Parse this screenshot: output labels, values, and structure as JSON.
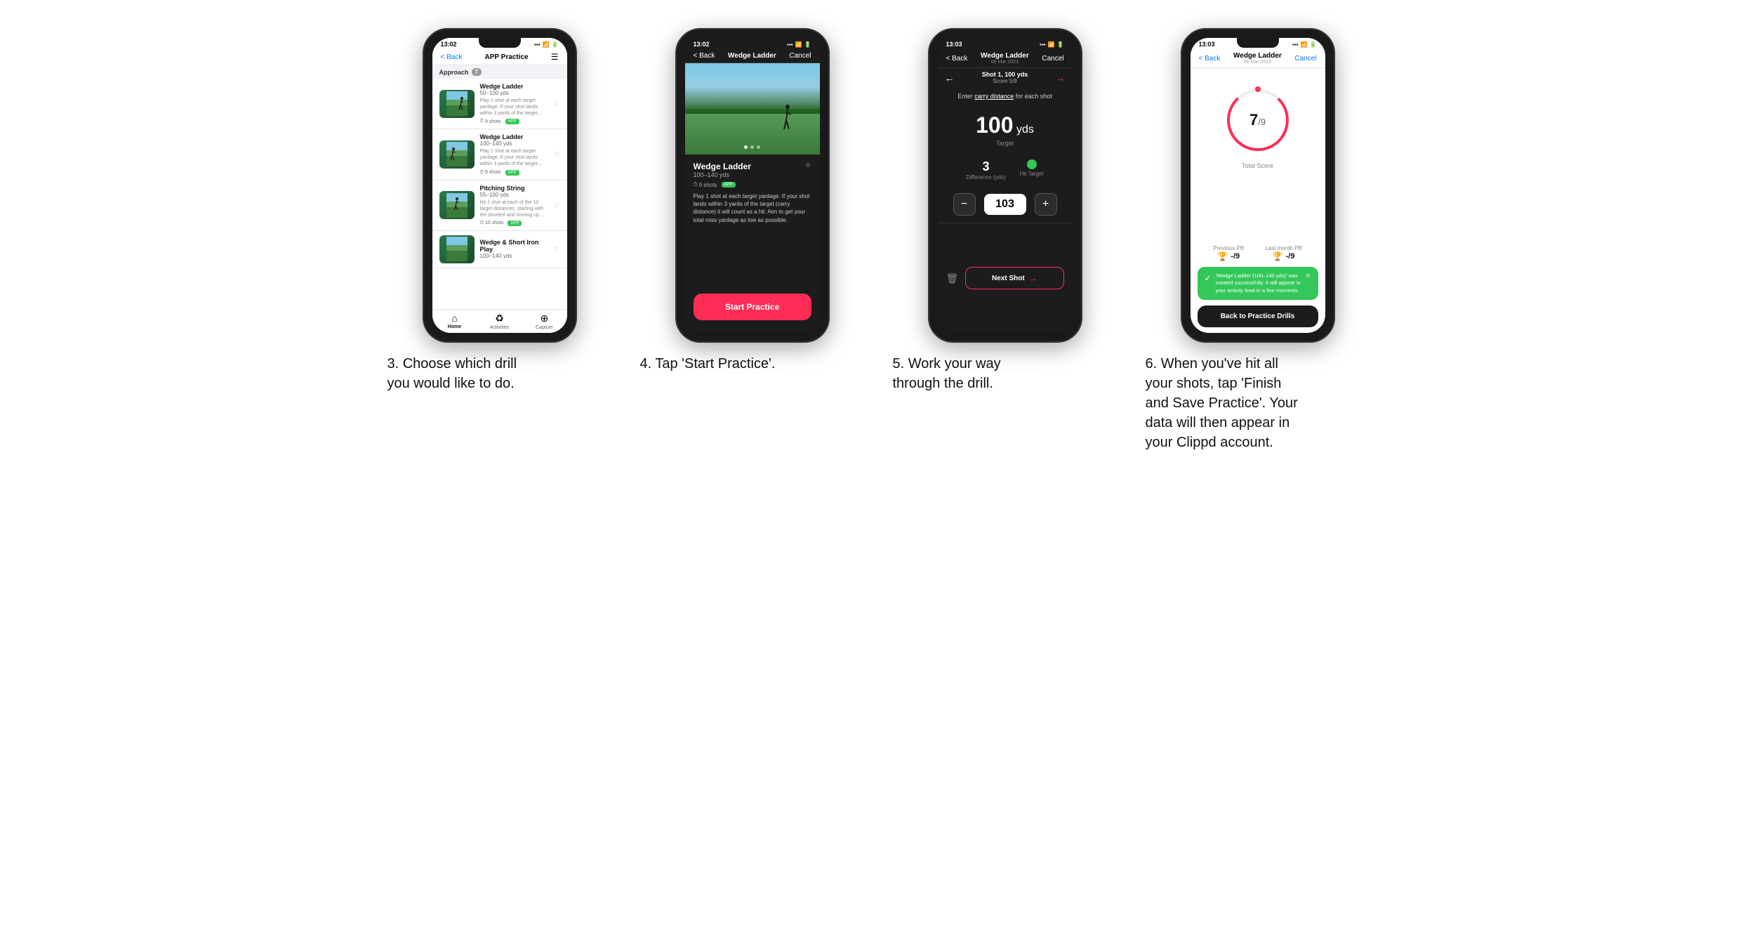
{
  "phones": [
    {
      "id": "phone3",
      "time": "13:02",
      "theme": "light",
      "nav": {
        "back_label": "< Back",
        "title": "APP Practice",
        "menu_icon": "☰"
      },
      "section_label": "Approach",
      "section_count": "7",
      "drills": [
        {
          "name": "Wedge Ladder",
          "distance": "50–100 yds",
          "desc": "Play 1 shot at each target yardage. If your shot lands within 3 yards of the target…",
          "shots": "9 shots",
          "badge": "APP"
        },
        {
          "name": "Wedge Ladder",
          "distance": "100–140 yds",
          "desc": "Play 1 shot at each target yardage. If your shot lands within 3 yards of the target…",
          "shots": "9 shots",
          "badge": "APP"
        },
        {
          "name": "Pitching String",
          "distance": "55–100 yds",
          "desc": "Hit 1 shot at each of the 10 target distances, starting with the shortest and moving up…",
          "shots": "10 shots",
          "badge": "APP"
        },
        {
          "name": "Wedge & Short Iron Play",
          "distance": "100–140 yds",
          "desc": "",
          "shots": "",
          "badge": ""
        }
      ],
      "tabs": [
        {
          "label": "Home",
          "icon": "⌂",
          "active": true
        },
        {
          "label": "Activities",
          "icon": "♻",
          "active": false
        },
        {
          "label": "Capture",
          "icon": "⊕",
          "active": false
        }
      ]
    },
    {
      "id": "phone4",
      "time": "13:02",
      "theme": "dark",
      "nav": {
        "back_label": "< Back",
        "title": "Wedge Ladder",
        "cancel_label": "Cancel"
      },
      "drill_name": "Wedge Ladder",
      "drill_distance": "100–140 yds",
      "drill_shots": "9 shots",
      "drill_desc": "Play 1 shot at each target yardage. If your shot lands within 3 yards of the target (carry distance) it will count as a hit. Aim to get your total miss yardage as low as possible.",
      "start_btn_label": "Start Practice"
    },
    {
      "id": "phone5",
      "time": "13:03",
      "theme": "dark",
      "nav": {
        "back_label": "< Back",
        "title_line1": "Wedge Ladder",
        "title_line2": "06 Mar 2023",
        "cancel_label": "Cancel"
      },
      "shot_nav": {
        "shot_label": "Shot 1, 100 yds",
        "score_label": "Score 5/9"
      },
      "carry_prompt": "Enter carry distance for each shot",
      "target_yds": "100",
      "target_unit": "yds",
      "target_label": "Target",
      "difference_val": "3",
      "difference_label": "Difference (yds)",
      "hit_target_label": "Hit Target",
      "input_value": "103",
      "next_shot_label": "Next Shot"
    },
    {
      "id": "phone6",
      "time": "13:03",
      "theme": "light",
      "nav": {
        "back_label": "< Back",
        "title_line1": "Wedge Ladder",
        "title_line2": "06 Mar 2023",
        "cancel_label": "Cancel"
      },
      "score_num": "7",
      "score_denom": "/9",
      "total_score_label": "Total Score",
      "previous_pb_label": "Previous PB",
      "previous_pb_val": "-/9",
      "last_month_pb_label": "Last month PB",
      "last_month_pb_val": "-/9",
      "toast_text": "'Wedge Ladder (100–140 yds)' was created successfully. It will appear in your activity feed in a few moments.",
      "back_btn_label": "Back to Practice Drills"
    }
  ],
  "captions": [
    {
      "text": "3. Choose which drill you would like to do."
    },
    {
      "text": "4. Tap 'Start Practice'."
    },
    {
      "text": "5. Work your way through the drill."
    },
    {
      "text": "6. When you've hit all your shots, tap 'Finish and Save Practice'. Your data will then appear in your Clippd account."
    }
  ]
}
